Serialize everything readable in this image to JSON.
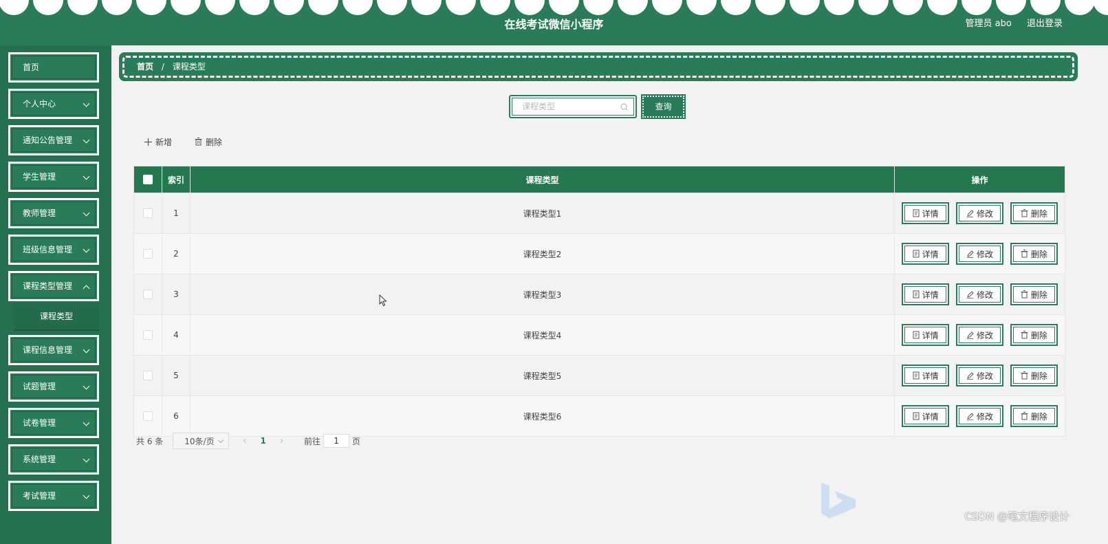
{
  "header": {
    "title": "在线考试微信小程序",
    "user": "管理员 abo",
    "logout": "退出登录"
  },
  "sidebar": {
    "items": [
      {
        "label": "首页"
      },
      {
        "label": "个人中心"
      },
      {
        "label": "通知公告管理"
      },
      {
        "label": "学生管理"
      },
      {
        "label": "教师管理"
      },
      {
        "label": "班级信息管理"
      },
      {
        "label": "课程类型管理"
      },
      {
        "label": "课程信息管理"
      },
      {
        "label": "试题管理"
      },
      {
        "label": "试卷管理"
      },
      {
        "label": "系统管理"
      },
      {
        "label": "考试管理"
      }
    ],
    "submenu_active": "课程类型"
  },
  "breadcrumb": {
    "home": "首页",
    "separator": "/",
    "current": "课程类型"
  },
  "search": {
    "placeholder": "课程类型",
    "value": "",
    "query_label": "查询"
  },
  "toolbar": {
    "add_label": "新增",
    "delete_label": "删除"
  },
  "table": {
    "columns": [
      "索引",
      "课程类型",
      "操作"
    ],
    "rows": [
      {
        "index": "1",
        "type": "课程类型1"
      },
      {
        "index": "2",
        "type": "课程类型2"
      },
      {
        "index": "3",
        "type": "课程类型3"
      },
      {
        "index": "4",
        "type": "课程类型4"
      },
      {
        "index": "5",
        "type": "课程类型5"
      },
      {
        "index": "6",
        "type": "课程类型6"
      }
    ],
    "actions": {
      "detail": "详情",
      "edit": "修改",
      "delete": "删除"
    }
  },
  "pagination": {
    "total": "共 6 条",
    "page_size": "10条/页",
    "current_page": "1",
    "goto_label": "前往",
    "goto_value": "1",
    "goto_unit": "页"
  },
  "watermark": "CSDN @笔文程序设计",
  "colors": {
    "primary": "#2a7b57",
    "header_th": "#237850",
    "background": "#f2f2f2"
  }
}
